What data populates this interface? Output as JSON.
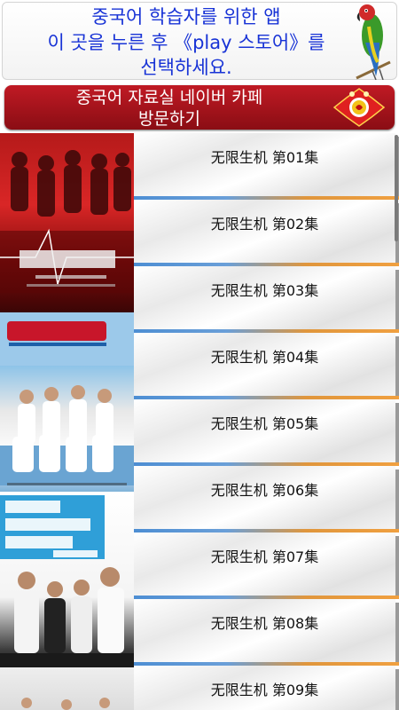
{
  "banner": {
    "line1": "중국어 학습자를 위한 앱",
    "line2": "이 곳을 누른 후 《play 스토어》를",
    "line3": "선택하세요.",
    "icon": "parrot-icon"
  },
  "cafe": {
    "line1": "중국어 자료실 네이버 카페",
    "line2": "방문하기",
    "icon": "lucky-knot-icon",
    "color": "#b0151e"
  },
  "posters": [
    {
      "icon": "drama-poster-red"
    },
    {
      "icon": "drama-poster-er"
    },
    {
      "icon": "drama-poster-distance-of-love"
    },
    {
      "icon": "drama-poster"
    }
  ],
  "episodes": [
    {
      "label": "无限生机 第01集"
    },
    {
      "label": "无限生机 第02集"
    },
    {
      "label": "无限生机 第03集"
    },
    {
      "label": "无限生机 第04集"
    },
    {
      "label": "无限生机 第05集"
    },
    {
      "label": "无限生机 第06集"
    },
    {
      "label": "无限生机 第07集"
    },
    {
      "label": "无限生机 第08集"
    },
    {
      "label": "无限生机 第09集"
    }
  ]
}
